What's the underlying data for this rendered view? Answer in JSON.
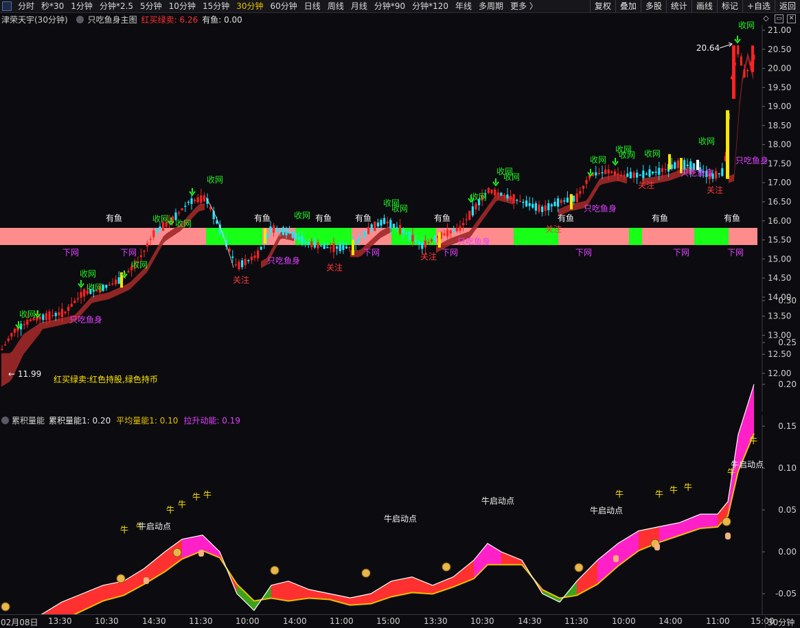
{
  "toolbar": {
    "periods": [
      "分时",
      "秒*30",
      "1分钟",
      "分钟*2.5",
      "5分钟",
      "10分钟",
      "15分钟",
      "30分钟",
      "60分钟",
      "日线",
      "周线",
      "月线",
      "分钟*90",
      "分钟*120",
      "年线",
      "多周期",
      "更多 〉"
    ],
    "active_period": "30分钟",
    "tools": [
      "复权",
      "叠加",
      "多股",
      "统计",
      "画线",
      "标记",
      "+自选",
      "返回"
    ]
  },
  "main": {
    "stock_title": "津荣天宇(30分钟)",
    "indicator_name": "只吃鱼身主图",
    "red_buy_label": "红买绿卖: 6.26",
    "has_fish_label": "有鱼: 0.00",
    "legend_note": "红买绿卖:红色持股,绿色持币",
    "high_price": "20.64",
    "low_price": "11.99",
    "y_ticks": [
      "21.00",
      "20.50",
      "20.00",
      "19.50",
      "19.00",
      "18.50",
      "18.00",
      "17.50",
      "17.00",
      "16.50",
      "16.00",
      "15.50",
      "15.00",
      "14.50",
      "14.00",
      "13.50",
      "13.00",
      "12.50",
      "12.00"
    ],
    "annotations": {
      "shouwang": "收网",
      "youyu": "有鱼",
      "xiawang": "下网",
      "guanzhu": "关注",
      "zhichiyushen": "只吃鱼身"
    },
    "colors": {
      "up": "#ff2222",
      "down": "#22e5ff",
      "ribbon": "#a02828",
      "band_red": "#ff8c8c",
      "band_green": "#18ff18",
      "yellow": "#ffe600",
      "purple": "#e040ff"
    }
  },
  "sub": {
    "indicator_name": "累积量能",
    "label1": "累积量能1: 0.20",
    "label2": "平均量能1: 0.10",
    "label3": "拉升动能: 0.19",
    "y_ticks": [
      "0.30",
      "0.25",
      "0.20",
      "0.15",
      "0.10",
      "0.05",
      "0.00",
      "-0.05"
    ],
    "bull_label": "牛",
    "bull_start_label": "牛启动点"
  },
  "xaxis": {
    "labels": [
      "02月08日",
      "13:30",
      "10:30",
      "14:30",
      "11:30",
      "10:00",
      "14:00",
      "11:00",
      "15:00",
      "13:30",
      "10:30",
      "14:30",
      "11:30",
      "10:00",
      "14:00",
      "11:00",
      "15:00"
    ],
    "period_label": "30分钟"
  }
}
